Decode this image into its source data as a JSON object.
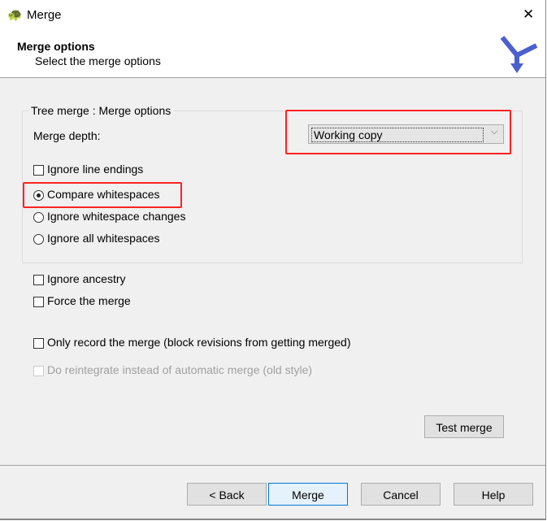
{
  "window": {
    "title": "Merge",
    "close_icon": "close-icon",
    "app_icon": "tortoise-icon"
  },
  "header": {
    "title": "Merge options",
    "subtitle": "Select the merge options",
    "logo_icon": "merge-arrow-icon"
  },
  "group": {
    "legend": "Tree merge : Merge options",
    "depth_label": "Merge depth:",
    "depth_value": "Working copy",
    "ignore_line_endings": {
      "label": "Ignore line endings",
      "checked": false
    },
    "whitespace_options": [
      {
        "label": "Compare whitespaces",
        "selected": true
      },
      {
        "label": "Ignore whitespace changes",
        "selected": false
      },
      {
        "label": "Ignore all whitespaces",
        "selected": false
      }
    ]
  },
  "options": [
    {
      "label": "Ignore ancestry",
      "checked": false,
      "enabled": true
    },
    {
      "label": "Force the merge",
      "checked": false,
      "enabled": true
    },
    {
      "label": "Only record the merge (block revisions from getting merged)",
      "checked": false,
      "enabled": true
    },
    {
      "label": "Do reintegrate instead of automatic merge (old style)",
      "checked": false,
      "enabled": false
    }
  ],
  "buttons": {
    "test_merge": "Test merge",
    "back": "< Back",
    "merge": "Merge",
    "cancel": "Cancel",
    "help": "Help"
  },
  "colors": {
    "highlight": "#ff2222",
    "default_button": "#0078d7"
  }
}
